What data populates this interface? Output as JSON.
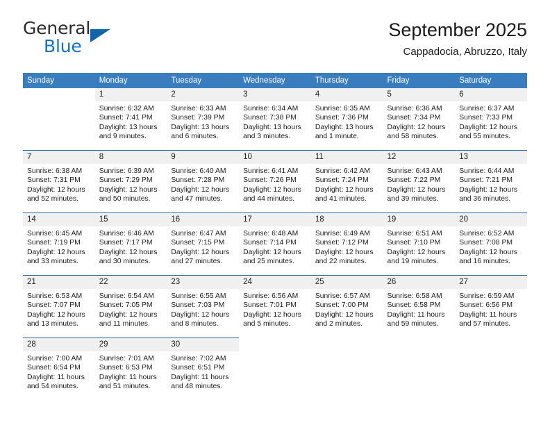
{
  "brand": {
    "name_part1": "General",
    "name_part2": "Blue",
    "triangle_color": "#1165ab",
    "blue_color": "#1273c4"
  },
  "header": {
    "title": "September 2025",
    "subtitle": "Cappadocia, Abruzzo, Italy"
  },
  "theme": {
    "header_row_bg": "#3a7dbf",
    "row_divider": "#2e6da4",
    "daynum_bg": "#f0f0f0"
  },
  "weekday_headers": [
    "Sunday",
    "Monday",
    "Tuesday",
    "Wednesday",
    "Thursday",
    "Friday",
    "Saturday"
  ],
  "weeks": [
    [
      {
        "day": "",
        "sunrise": "",
        "sunset": "",
        "daylight_line1": "",
        "daylight_line2": "",
        "empty": true
      },
      {
        "day": "1",
        "sunrise": "Sunrise: 6:32 AM",
        "sunset": "Sunset: 7:41 PM",
        "daylight_line1": "Daylight: 13 hours",
        "daylight_line2": "and 9 minutes."
      },
      {
        "day": "2",
        "sunrise": "Sunrise: 6:33 AM",
        "sunset": "Sunset: 7:39 PM",
        "daylight_line1": "Daylight: 13 hours",
        "daylight_line2": "and 6 minutes."
      },
      {
        "day": "3",
        "sunrise": "Sunrise: 6:34 AM",
        "sunset": "Sunset: 7:38 PM",
        "daylight_line1": "Daylight: 13 hours",
        "daylight_line2": "and 3 minutes."
      },
      {
        "day": "4",
        "sunrise": "Sunrise: 6:35 AM",
        "sunset": "Sunset: 7:36 PM",
        "daylight_line1": "Daylight: 13 hours",
        "daylight_line2": "and 1 minute."
      },
      {
        "day": "5",
        "sunrise": "Sunrise: 6:36 AM",
        "sunset": "Sunset: 7:34 PM",
        "daylight_line1": "Daylight: 12 hours",
        "daylight_line2": "and 58 minutes."
      },
      {
        "day": "6",
        "sunrise": "Sunrise: 6:37 AM",
        "sunset": "Sunset: 7:33 PM",
        "daylight_line1": "Daylight: 12 hours",
        "daylight_line2": "and 55 minutes."
      }
    ],
    [
      {
        "day": "7",
        "sunrise": "Sunrise: 6:38 AM",
        "sunset": "Sunset: 7:31 PM",
        "daylight_line1": "Daylight: 12 hours",
        "daylight_line2": "and 52 minutes."
      },
      {
        "day": "8",
        "sunrise": "Sunrise: 6:39 AM",
        "sunset": "Sunset: 7:29 PM",
        "daylight_line1": "Daylight: 12 hours",
        "daylight_line2": "and 50 minutes."
      },
      {
        "day": "9",
        "sunrise": "Sunrise: 6:40 AM",
        "sunset": "Sunset: 7:28 PM",
        "daylight_line1": "Daylight: 12 hours",
        "daylight_line2": "and 47 minutes."
      },
      {
        "day": "10",
        "sunrise": "Sunrise: 6:41 AM",
        "sunset": "Sunset: 7:26 PM",
        "daylight_line1": "Daylight: 12 hours",
        "daylight_line2": "and 44 minutes."
      },
      {
        "day": "11",
        "sunrise": "Sunrise: 6:42 AM",
        "sunset": "Sunset: 7:24 PM",
        "daylight_line1": "Daylight: 12 hours",
        "daylight_line2": "and 41 minutes."
      },
      {
        "day": "12",
        "sunrise": "Sunrise: 6:43 AM",
        "sunset": "Sunset: 7:22 PM",
        "daylight_line1": "Daylight: 12 hours",
        "daylight_line2": "and 39 minutes."
      },
      {
        "day": "13",
        "sunrise": "Sunrise: 6:44 AM",
        "sunset": "Sunset: 7:21 PM",
        "daylight_line1": "Daylight: 12 hours",
        "daylight_line2": "and 36 minutes."
      }
    ],
    [
      {
        "day": "14",
        "sunrise": "Sunrise: 6:45 AM",
        "sunset": "Sunset: 7:19 PM",
        "daylight_line1": "Daylight: 12 hours",
        "daylight_line2": "and 33 minutes."
      },
      {
        "day": "15",
        "sunrise": "Sunrise: 6:46 AM",
        "sunset": "Sunset: 7:17 PM",
        "daylight_line1": "Daylight: 12 hours",
        "daylight_line2": "and 30 minutes."
      },
      {
        "day": "16",
        "sunrise": "Sunrise: 6:47 AM",
        "sunset": "Sunset: 7:15 PM",
        "daylight_line1": "Daylight: 12 hours",
        "daylight_line2": "and 27 minutes."
      },
      {
        "day": "17",
        "sunrise": "Sunrise: 6:48 AM",
        "sunset": "Sunset: 7:14 PM",
        "daylight_line1": "Daylight: 12 hours",
        "daylight_line2": "and 25 minutes."
      },
      {
        "day": "18",
        "sunrise": "Sunrise: 6:49 AM",
        "sunset": "Sunset: 7:12 PM",
        "daylight_line1": "Daylight: 12 hours",
        "daylight_line2": "and 22 minutes."
      },
      {
        "day": "19",
        "sunrise": "Sunrise: 6:51 AM",
        "sunset": "Sunset: 7:10 PM",
        "daylight_line1": "Daylight: 12 hours",
        "daylight_line2": "and 19 minutes."
      },
      {
        "day": "20",
        "sunrise": "Sunrise: 6:52 AM",
        "sunset": "Sunset: 7:08 PM",
        "daylight_line1": "Daylight: 12 hours",
        "daylight_line2": "and 16 minutes."
      }
    ],
    [
      {
        "day": "21",
        "sunrise": "Sunrise: 6:53 AM",
        "sunset": "Sunset: 7:07 PM",
        "daylight_line1": "Daylight: 12 hours",
        "daylight_line2": "and 13 minutes."
      },
      {
        "day": "22",
        "sunrise": "Sunrise: 6:54 AM",
        "sunset": "Sunset: 7:05 PM",
        "daylight_line1": "Daylight: 12 hours",
        "daylight_line2": "and 11 minutes."
      },
      {
        "day": "23",
        "sunrise": "Sunrise: 6:55 AM",
        "sunset": "Sunset: 7:03 PM",
        "daylight_line1": "Daylight: 12 hours",
        "daylight_line2": "and 8 minutes."
      },
      {
        "day": "24",
        "sunrise": "Sunrise: 6:56 AM",
        "sunset": "Sunset: 7:01 PM",
        "daylight_line1": "Daylight: 12 hours",
        "daylight_line2": "and 5 minutes."
      },
      {
        "day": "25",
        "sunrise": "Sunrise: 6:57 AM",
        "sunset": "Sunset: 7:00 PM",
        "daylight_line1": "Daylight: 12 hours",
        "daylight_line2": "and 2 minutes."
      },
      {
        "day": "26",
        "sunrise": "Sunrise: 6:58 AM",
        "sunset": "Sunset: 6:58 PM",
        "daylight_line1": "Daylight: 11 hours",
        "daylight_line2": "and 59 minutes."
      },
      {
        "day": "27",
        "sunrise": "Sunrise: 6:59 AM",
        "sunset": "Sunset: 6:56 PM",
        "daylight_line1": "Daylight: 11 hours",
        "daylight_line2": "and 57 minutes."
      }
    ],
    [
      {
        "day": "28",
        "sunrise": "Sunrise: 7:00 AM",
        "sunset": "Sunset: 6:54 PM",
        "daylight_line1": "Daylight: 11 hours",
        "daylight_line2": "and 54 minutes."
      },
      {
        "day": "29",
        "sunrise": "Sunrise: 7:01 AM",
        "sunset": "Sunset: 6:53 PM",
        "daylight_line1": "Daylight: 11 hours",
        "daylight_line2": "and 51 minutes."
      },
      {
        "day": "30",
        "sunrise": "Sunrise: 7:02 AM",
        "sunset": "Sunset: 6:51 PM",
        "daylight_line1": "Daylight: 11 hours",
        "daylight_line2": "and 48 minutes."
      },
      {
        "day": "",
        "sunrise": "",
        "sunset": "",
        "daylight_line1": "",
        "daylight_line2": "",
        "empty": true
      },
      {
        "day": "",
        "sunrise": "",
        "sunset": "",
        "daylight_line1": "",
        "daylight_line2": "",
        "empty": true
      },
      {
        "day": "",
        "sunrise": "",
        "sunset": "",
        "daylight_line1": "",
        "daylight_line2": "",
        "empty": true
      },
      {
        "day": "",
        "sunrise": "",
        "sunset": "",
        "daylight_line1": "",
        "daylight_line2": "",
        "empty": true
      }
    ]
  ]
}
